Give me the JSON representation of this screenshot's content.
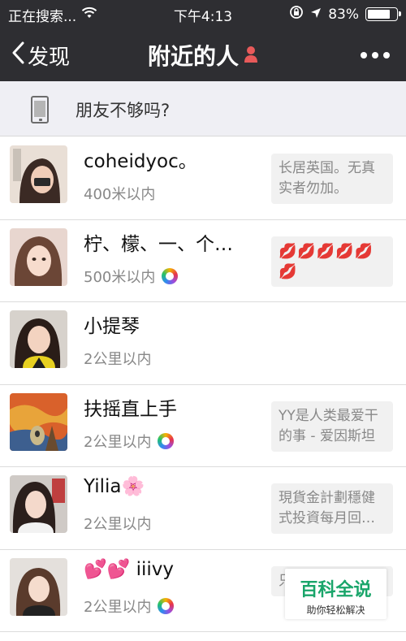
{
  "status_bar": {
    "carrier": "正在搜索...",
    "time": "下午4:13",
    "battery_pct": "83%",
    "battery_level": 0.83
  },
  "nav": {
    "back_label": "发现",
    "title": "附近的人",
    "title_icon": "female-person-icon",
    "more_icon": "more-dots-icon"
  },
  "banner": {
    "text": "朋友不够吗?",
    "icon": "phone-icon"
  },
  "people": [
    {
      "name": "coheidyoc。",
      "distance": "400米以内",
      "signature": "长居英国。无真实者勿加。",
      "has_moments": false
    },
    {
      "name": "柠、檬、一、个…",
      "distance": "500米以内",
      "signature": "💋💋💋💋💋💋",
      "has_moments": true
    },
    {
      "name": "小提琴",
      "distance": "2公里以内",
      "signature": "",
      "has_moments": false
    },
    {
      "name": "扶摇直上手",
      "distance": "2公里以内",
      "signature": "YY是人类最爱干的事 - 爱因斯坦",
      "has_moments": true
    },
    {
      "name": "Yilia🌸",
      "distance": "2公里以内",
      "signature": "現貨金計劃穩健式投資每月回…",
      "has_moments": false
    },
    {
      "name": "💕💕 iiivy",
      "distance": "2公里以内",
      "signature": "只免",
      "has_moments": true
    }
  ],
  "watermark": {
    "main": "百科全说",
    "sub": "助你轻松解决"
  },
  "colors": {
    "bar_bg": "#2e2e32",
    "banner_bg": "#efeff4",
    "watermark_green": "#19a56a"
  }
}
